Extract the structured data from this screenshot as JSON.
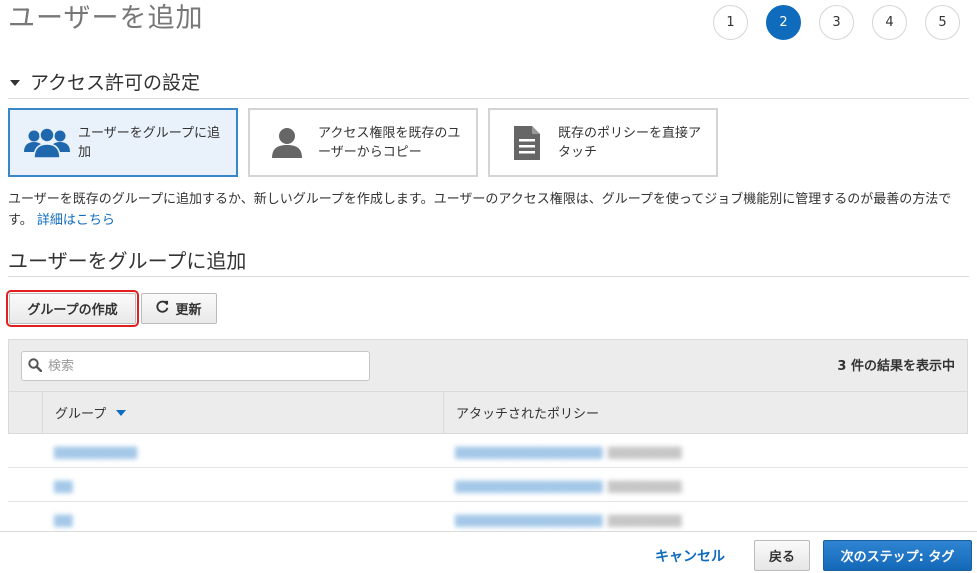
{
  "page": {
    "title": "ユーザーを追加"
  },
  "steps": [
    {
      "label": "1",
      "active": false
    },
    {
      "label": "2",
      "active": true
    },
    {
      "label": "3",
      "active": false
    },
    {
      "label": "4",
      "active": false
    },
    {
      "label": "5",
      "active": false
    }
  ],
  "permissions": {
    "heading": "アクセス許可の設定",
    "options": [
      {
        "label": "ユーザーをグループに追加",
        "icon": "users-group-icon",
        "selected": true
      },
      {
        "label": "アクセス権限を既存のユーザーからコピー",
        "icon": "user-icon",
        "selected": false
      },
      {
        "label": "既存のポリシーを直接アタッチ",
        "icon": "document-icon",
        "selected": false
      }
    ],
    "description": "ユーザーを既存のグループに追加するか、新しいグループを作成します。ユーザーのアクセス権限は、グループを使ってジョブ機能別に管理するのが最善の方法です。",
    "learn_more": "詳細はこちら"
  },
  "groups": {
    "heading": "ユーザーをグループに追加",
    "create_button": "グループの作成",
    "refresh_button": "更新",
    "search_placeholder": "検索",
    "result_count": "3 件の結果を表示中",
    "columns": {
      "group": "グループ",
      "policy": "アタッチされたポリシー"
    }
  },
  "footer": {
    "cancel": "キャンセル",
    "back": "戻る",
    "next": "次のステップ: タグ"
  },
  "colors": {
    "accent": "#0f6cbd",
    "selected_border": "#3a87c8",
    "highlight_outline": "#e02020"
  }
}
